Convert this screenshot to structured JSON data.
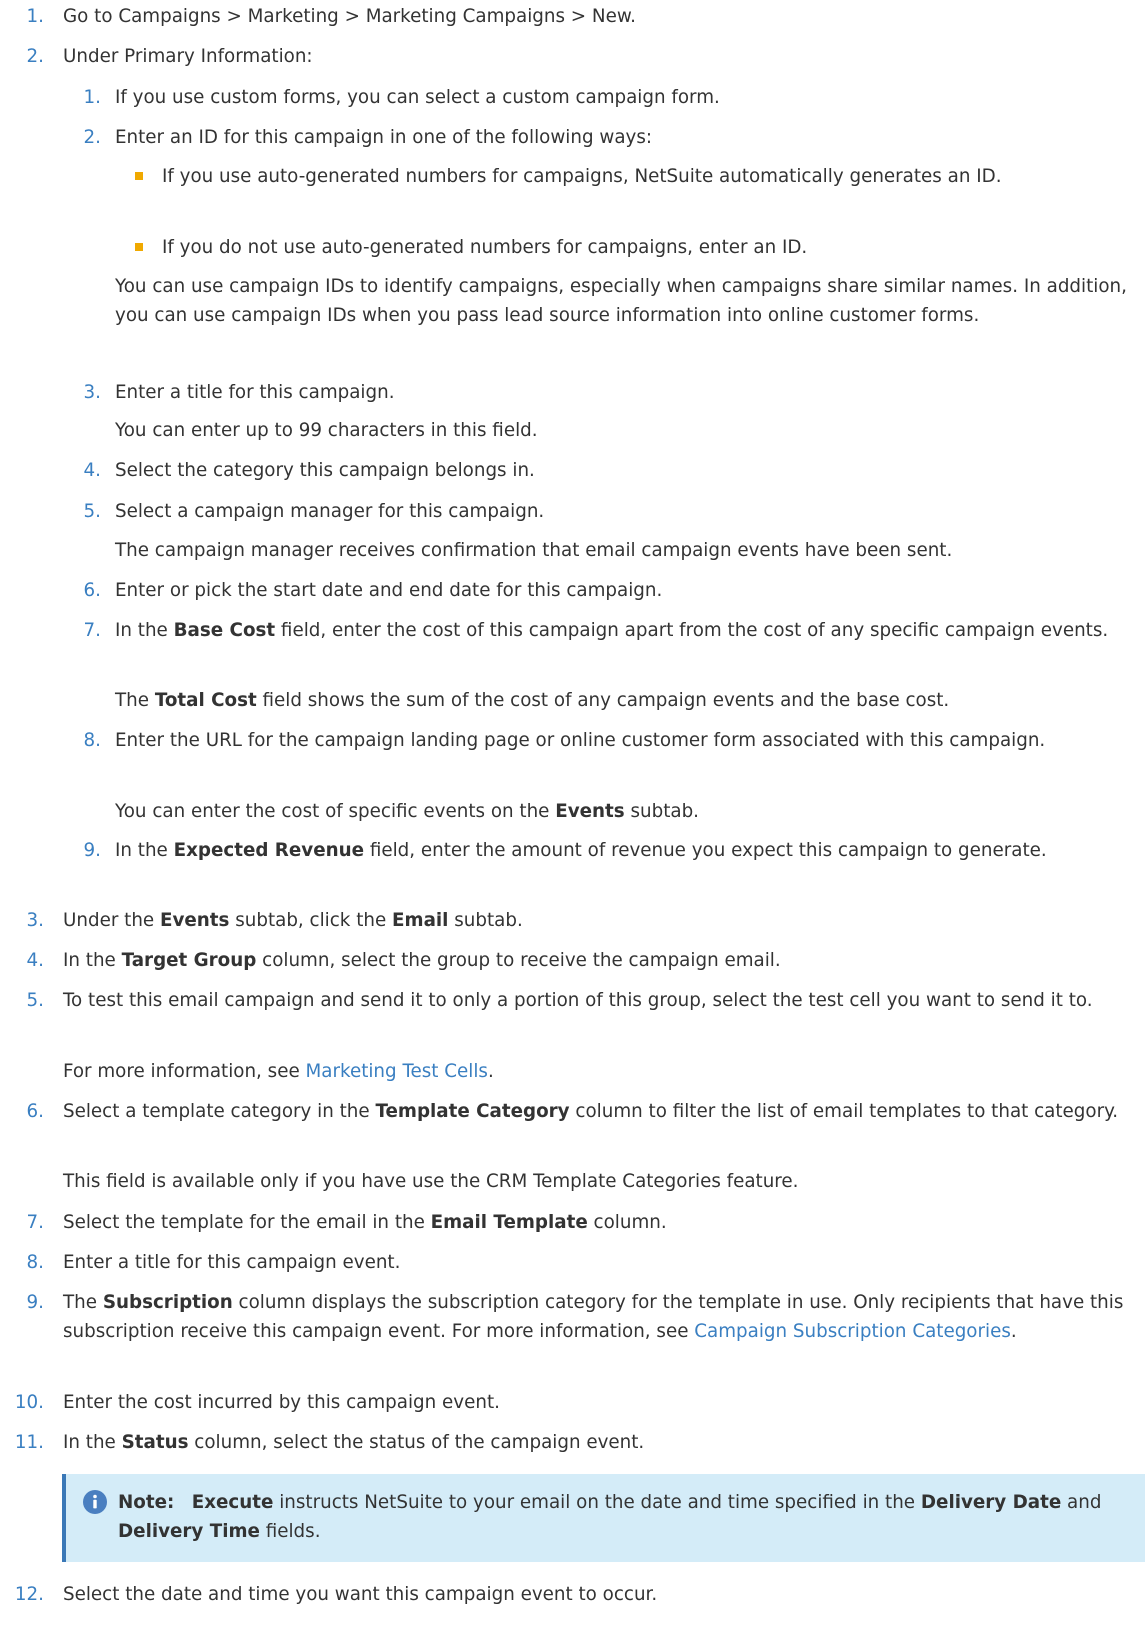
{
  "steps": {
    "s1": {
      "num": "1.",
      "text": "Go to Campaigns > Marketing > Marketing Campaigns > New."
    },
    "s2": {
      "num": "2.",
      "text": "Under Primary Information:"
    },
    "s2_1": {
      "num": "1.",
      "text": "If you use custom forms, you can select a custom campaign form."
    },
    "s2_2": {
      "num": "2.",
      "text": "Enter an ID for this campaign in one of the following ways:",
      "bullets": [
        "If you use auto-generated numbers for campaigns, NetSuite automatically generates an ID.",
        "If you do not use auto-generated numbers for campaigns, enter an ID."
      ],
      "para": "You can use campaign IDs to identify campaigns, especially when campaigns share similar names. In addition, you can use campaign IDs when you pass lead source information into online customer forms."
    },
    "s2_3": {
      "num": "3.",
      "text": "Enter a title for this campaign.",
      "para": "You can enter up to 99 characters in this field."
    },
    "s2_4": {
      "num": "4.",
      "text": "Select the category this campaign belongs in."
    },
    "s2_5": {
      "num": "5.",
      "text": "Select a campaign manager for this campaign.",
      "para": "The campaign manager receives confirmation that email campaign events have been sent."
    },
    "s2_6": {
      "num": "6.",
      "text": "Enter or pick the start date and end date for this campaign."
    },
    "s2_7": {
      "num": "7.",
      "pre": "In the ",
      "bold": "Base Cost",
      "post": " field, enter the cost of this campaign apart from the cost of any specific campaign events.",
      "para_pre": "The ",
      "para_bold": "Total Cost",
      "para_post": " field shows the sum of the cost of any campaign events and the base cost."
    },
    "s2_8": {
      "num": "8.",
      "text": "Enter the URL for the campaign landing page or online customer form associated with this campaign.",
      "para_pre": "You can enter the cost of specific events on the ",
      "para_bold": "Events",
      "para_post": " subtab."
    },
    "s2_9": {
      "num": "9.",
      "pre": "In the ",
      "bold": "Expected Revenue",
      "post": " field, enter the amount of revenue you expect this campaign to generate."
    },
    "s3": {
      "num": "3.",
      "pre": "Under the ",
      "bold1": "Events",
      "mid": " subtab, click the ",
      "bold2": "Email",
      "post": " subtab."
    },
    "s4": {
      "num": "4.",
      "pre": "In the ",
      "bold": "Target Group",
      "post": " column, select the group to receive the campaign email."
    },
    "s5": {
      "num": "5.",
      "text": "To test this email campaign and send it to only a portion of this group, select the test cell you want to send it to.",
      "para_pre": "For more information, see ",
      "link": "Marketing Test Cells",
      "para_post": "."
    },
    "s6": {
      "num": "6.",
      "pre": "Select a template category in the ",
      "bold": "Template Category",
      "post": " column to filter the list of email templates to that category.",
      "para": "This field is available only if you have use the CRM Template Categories feature."
    },
    "s7": {
      "num": "7.",
      "pre": "Select the template for the email in the ",
      "bold": "Email Template",
      "post": " column."
    },
    "s8": {
      "num": "8.",
      "text": "Enter a title for this campaign event."
    },
    "s9": {
      "num": "9.",
      "pre": "The ",
      "bold": "Subscription",
      "post": " column displays the subscription category for the template in use. Only recipients that have this subscription receive this campaign event. For more information, see ",
      "link": "Campaign Subscription Categories",
      "end": "."
    },
    "s10": {
      "num": "10.",
      "text": "Enter the cost incurred by this campaign event."
    },
    "s11": {
      "num": "11.",
      "pre": "In the ",
      "bold": "Status",
      "post": " column, select the status of the campaign event."
    },
    "s12": {
      "num": "12.",
      "text": "Select the date and time you want this campaign event to occur."
    }
  },
  "note": {
    "icon": "info-icon",
    "label": "Note:",
    "bold1": "Execute",
    "t1": " instructs NetSuite to your email on the date and time specified in the ",
    "bold2": "Delivery Date",
    "t2": " and ",
    "bold3": "Delivery Time",
    "t3": " fields."
  },
  "colors": {
    "accent": "#3a7fc1",
    "bullet": "#f0a900",
    "note_bg": "#d4ecf8",
    "note_border": "#3a78b7"
  }
}
